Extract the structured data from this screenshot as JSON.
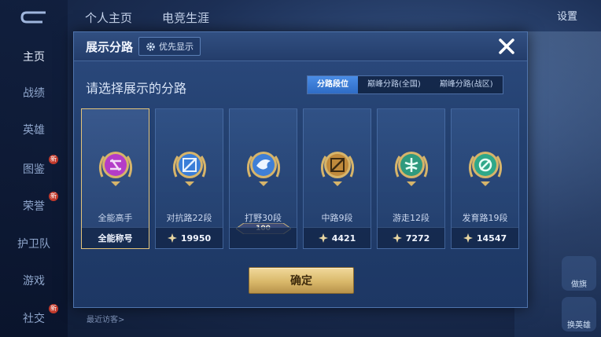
{
  "background": {
    "nav_items": [
      {
        "label": "主页",
        "active": true,
        "badge": ""
      },
      {
        "label": "战绩",
        "active": false,
        "badge": ""
      },
      {
        "label": "英雄",
        "active": false,
        "badge": ""
      },
      {
        "label": "图鉴",
        "active": false,
        "badge": "新"
      },
      {
        "label": "荣誉",
        "active": false,
        "badge": "新"
      },
      {
        "label": "护卫队",
        "active": false,
        "badge": ""
      },
      {
        "label": "游戏",
        "active": false,
        "badge": ""
      },
      {
        "label": "社交",
        "active": false,
        "badge": "新"
      }
    ],
    "top_tabs": [
      "个人主页",
      "电竞生涯"
    ],
    "settings_label": "设置",
    "visitors_label": "最近访客>",
    "side_buttons": [
      "做旗",
      "换英雄"
    ]
  },
  "dialog": {
    "title": "展示分路",
    "priority_label": "优先显示",
    "subtitle": "请选择展示的分路",
    "segments": [
      {
        "label": "分路段位",
        "active": true
      },
      {
        "label": "巅峰分路(全国)",
        "active": false
      },
      {
        "label": "巅峰分路(战区)",
        "active": false
      }
    ],
    "cards": [
      {
        "name": "全能高手",
        "footer": "全能称号",
        "has_star": false,
        "selected": true,
        "color": "#b43cc8"
      },
      {
        "name": "对抗路22段",
        "footer": "19950",
        "has_star": true,
        "selected": false,
        "color": "#3a7ed8"
      },
      {
        "name": "打野30段",
        "footer": "",
        "plaque": "100",
        "has_star": false,
        "selected": false,
        "color": "#3f7fd6"
      },
      {
        "name": "中路9段",
        "footer": "4421",
        "has_star": true,
        "selected": false,
        "color": "#c08a3c"
      },
      {
        "name": "游走12段",
        "footer": "7272",
        "has_star": true,
        "selected": false,
        "color": "#2f9a7e"
      },
      {
        "name": "发育路19段",
        "footer": "14547",
        "has_star": true,
        "selected": false,
        "color": "#2fa889"
      }
    ],
    "confirm_label": "确定"
  },
  "colors": {
    "accent_gold": "#e4c47a",
    "segment_active": "#3a7ed8",
    "dialog_bg": "#23406f"
  }
}
